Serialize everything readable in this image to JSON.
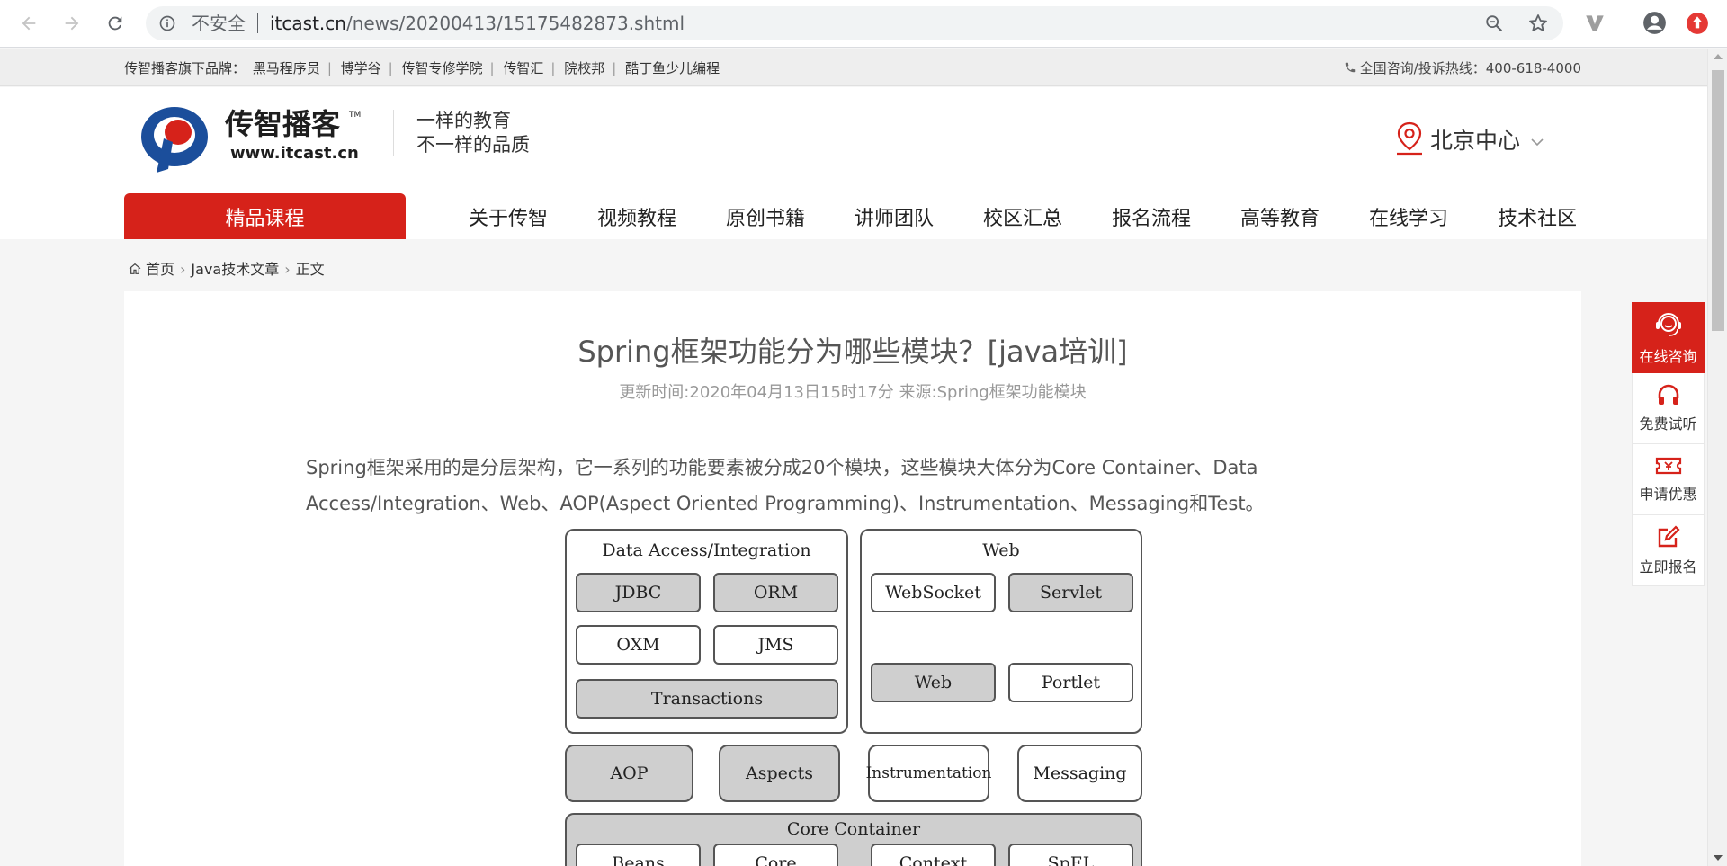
{
  "browser": {
    "security_label": "不安全",
    "url_host": "itcast.cn",
    "url_path": "/news/20200413/15175482873.shtml"
  },
  "topbar": {
    "brand_prefix": "传智播客旗下品牌：",
    "brands": [
      "黑马程序员",
      "博学谷",
      "传智专修学院",
      "传智汇",
      "院校邦",
      "酷丁鱼少儿编程"
    ],
    "hotline": "全国咨询/投诉热线：400-618-4000"
  },
  "header": {
    "logo_name": "传智播客",
    "logo_url": "www.itcast.cn",
    "logo_tm": "TM",
    "slogan_line1": "一样的教育",
    "slogan_line2": "不一样的品质",
    "city": "北京中心"
  },
  "nav": {
    "featured": "精品课程",
    "items": [
      "关于传智",
      "视频教程",
      "原创书籍",
      "讲师团队",
      "校区汇总",
      "报名流程",
      "高等教育",
      "在线学习",
      "技术社区"
    ]
  },
  "breadcrumb": {
    "home": "首页",
    "category": "Java技术文章",
    "current": "正文"
  },
  "article": {
    "title": "Spring框架功能分为哪些模块？[java培训]",
    "meta": "更新时间:2020年04月13日15时17分 来源:Spring框架功能模块",
    "paragraph": "Spring框架采用的是分层架构，它一系列的功能要素被分成20个模块，这些模块大体分为Core Container、Data Access/Integration、Web、AOP(Aspect Oriented Programming)、Instrumentation、Messaging和Test。"
  },
  "diagram": {
    "data_access_title": "Data Access/Integration",
    "jdbc": "JDBC",
    "orm": "ORM",
    "oxm": "OXM",
    "jms": "JMS",
    "transactions": "Transactions",
    "web_title": "Web",
    "websocket": "WebSocket",
    "servlet": "Servlet",
    "web": "Web",
    "portlet": "Portlet",
    "aop": "AOP",
    "aspects": "Aspects",
    "instrumentation": "Instrumentation",
    "messaging": "Messaging",
    "core_title": "Core Container",
    "beans": "Beans",
    "core": "Core",
    "context": "Context",
    "spel": "SpEL"
  },
  "float_bar": {
    "consult": "在线咨询",
    "trial": "免费试听",
    "discount": "申请优惠",
    "signup": "立即报名"
  },
  "colors": {
    "brand_red": "#d6221a",
    "diagram_gray": "#cfcfcf"
  }
}
